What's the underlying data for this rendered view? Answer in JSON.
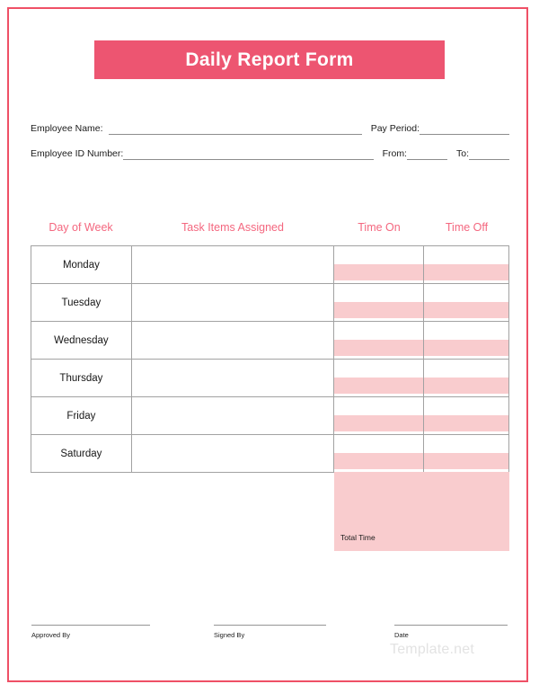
{
  "document": {
    "title": "Daily Report Form",
    "accent_color": "#ed5571",
    "border_color": "#ef5066",
    "header_label_color": "#f4677f",
    "band_color": "#f9ccce",
    "grid_line_color": "#a2a2a2"
  },
  "meta": {
    "employee_name_label": "Employee Name:",
    "employee_id_label": "Employee ID Number:",
    "pay_period_label": "Pay Period:",
    "from_label": "From:",
    "to_label": "To:",
    "employee_name_value": "",
    "employee_id_value": "",
    "pay_period_value": "",
    "from_value": "",
    "to_value": ""
  },
  "table": {
    "columns": [
      {
        "key": "day",
        "label": "Day of Week"
      },
      {
        "key": "task",
        "label": "Task Items Assigned"
      },
      {
        "key": "on",
        "label": "Time On"
      },
      {
        "key": "off",
        "label": "Time Off"
      }
    ],
    "rows": [
      {
        "day": "Monday",
        "task": "",
        "time_on": "",
        "time_off": ""
      },
      {
        "day": "Tuesday",
        "task": "",
        "time_on": "",
        "time_off": ""
      },
      {
        "day": "Wednesday",
        "task": "",
        "time_on": "",
        "time_off": ""
      },
      {
        "day": "Thursday",
        "task": "",
        "time_on": "",
        "time_off": ""
      },
      {
        "day": "Friday",
        "task": "",
        "time_on": "",
        "time_off": ""
      },
      {
        "day": "Saturday",
        "task": "",
        "time_on": "",
        "time_off": ""
      }
    ],
    "total_time_label": "Total Time",
    "total_time_value": ""
  },
  "footer": {
    "approved_by_label": "Approved By",
    "signed_by_label": "Signed By",
    "date_label": "Date",
    "approved_by_value": "",
    "signed_by_value": "",
    "date_value": ""
  },
  "watermark": {
    "text": "Template.net"
  }
}
